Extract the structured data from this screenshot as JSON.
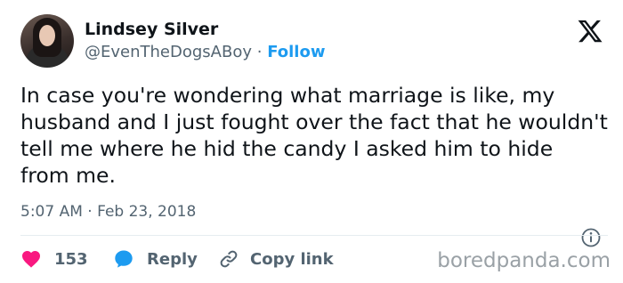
{
  "author": {
    "name": "Lindsey Silver",
    "handle": "@EvenTheDogsABoy",
    "separator": "·",
    "follow_label": "Follow"
  },
  "tweet": {
    "text": "In case you're wondering what marriage is like, my husband and I just fought over the fact that he wouldn't tell me where he hid the candy I asked him to hide from me.",
    "time": "5:07 AM",
    "date_separator": "·",
    "date": "Feb 23, 2018"
  },
  "actions": {
    "likes_count": "153",
    "reply_label": "Reply",
    "copy_link_label": "Copy link"
  },
  "watermark": "boredpanda.com",
  "colors": {
    "accent": "#1d9bf0",
    "like": "#f91880",
    "secondary_text": "#536471",
    "primary_text": "#0f1419"
  },
  "icons": [
    "x-logo-icon",
    "info-icon",
    "heart-icon",
    "reply-bubble-icon",
    "link-icon"
  ]
}
